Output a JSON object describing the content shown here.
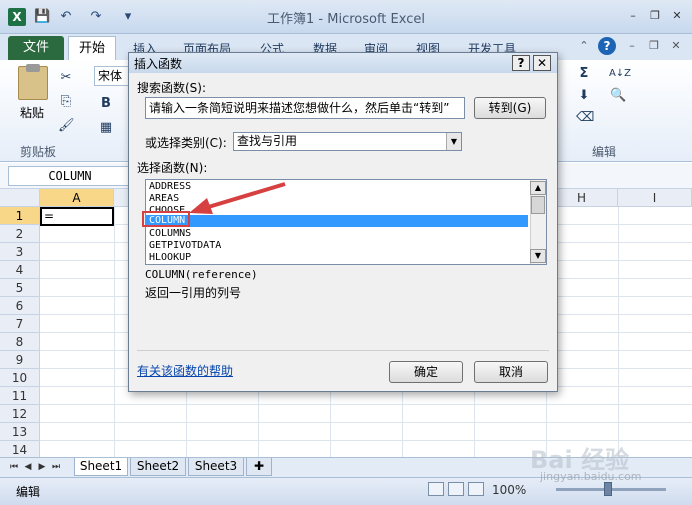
{
  "window": {
    "title": "工作簿1 - Microsoft Excel",
    "minimize": "–",
    "restore": "❐",
    "close": "✕"
  },
  "quick_access": {
    "save": "💾",
    "undo": "↶",
    "redo": "↷",
    "customize": "▾"
  },
  "app_logo": "X",
  "ribbon_tabs": {
    "file": "文件",
    "items": [
      "开始",
      "插入",
      "页面布局",
      "公式",
      "数据",
      "审阅",
      "视图",
      "开发工具"
    ]
  },
  "ribbon": {
    "paste_label": "粘贴",
    "clipboard_group": "剪贴板",
    "font_name": "宋体",
    "bold": "B",
    "editing_group": "编辑",
    "autosum": "Σ",
    "sort": "A↓Z",
    "find": "🔍"
  },
  "formula_bar": {
    "name_box": "COLUMN"
  },
  "grid": {
    "columns": [
      "A",
      "B",
      "C",
      "D",
      "E",
      "F",
      "G",
      "H",
      "I"
    ],
    "rows": [
      "1",
      "2",
      "3",
      "4",
      "5",
      "6",
      "7",
      "8",
      "9",
      "10",
      "11",
      "12",
      "13",
      "14"
    ],
    "active_cell_content": "="
  },
  "sheet_tabs": [
    "Sheet1",
    "Sheet2",
    "Sheet3"
  ],
  "status": {
    "mode": "编辑",
    "zoom": "100%"
  },
  "dialog": {
    "title": "插入函数",
    "help_btn": "?",
    "close_btn": "✕",
    "search_label": "搜索函数(S):",
    "search_value": "请输入一条简短说明来描述您想做什么，然后单击“转到”",
    "go_button": "转到(G)",
    "category_label": "或选择类别(C):",
    "category_value": "查找与引用",
    "function_label": "选择函数(N):",
    "functions": [
      "ADDRESS",
      "AREAS",
      "CHOOSE",
      "COLUMN",
      "COLUMNS",
      "GETPIVOTDATA",
      "HLOOKUP"
    ],
    "selected_function": "COLUMN",
    "signature": "COLUMN(reference)",
    "description": "返回一引用的列号",
    "help_link": "有关该函数的帮助",
    "ok_button": "确定",
    "cancel_button": "取消"
  },
  "watermark": {
    "text": "Bai 经验",
    "url": "jingyan.baidu.com"
  },
  "colors": {
    "file_tab": "#2b6a3e",
    "selection": "#3399ff",
    "annotation": "#d64040"
  }
}
